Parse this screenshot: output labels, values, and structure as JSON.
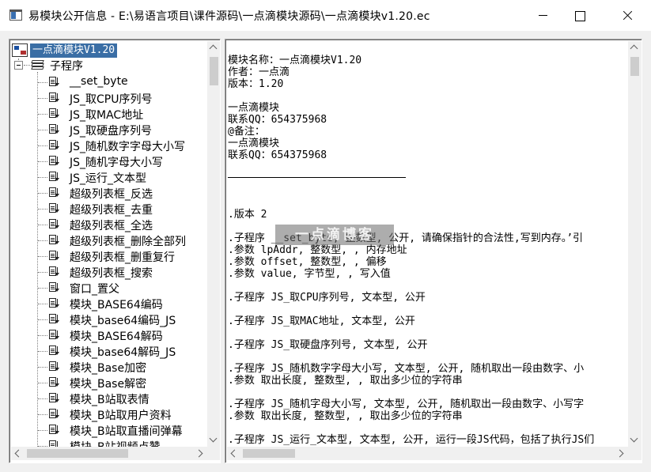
{
  "window": {
    "title": "易模块公开信息 - E:\\易语言项目\\课件源码\\一点滴模块源码\\一点滴模块v1.20.ec",
    "icon": "app-window-icon",
    "controls": [
      "minimize",
      "maximize",
      "close"
    ]
  },
  "tree": {
    "root_label": "一点滴模块V1.20",
    "root_icon": "module-icon",
    "folder_label": "子程序",
    "folder_icon": "stacked-books-icon",
    "item_icon": "subroutine-doc-arrow-icon",
    "items": [
      "__set_byte",
      "JS_取CPU序列号",
      "JS_取MAC地址",
      "JS_取硬盘序列号",
      "JS_随机数字字母大小写",
      "JS_随机字母大小写",
      "JS_运行_文本型",
      "超级列表框_反选",
      "超级列表框_去重",
      "超级列表框_全选",
      "超级列表框_删除全部列",
      "超级列表框_删重复行",
      "超级列表框_搜索",
      "窗口_置父",
      "模块_BASE64编码",
      "模块_base64编码_JS",
      "模块_BASE64解码",
      "模块_base64解码_JS",
      "模块_Base加密",
      "模块_Base解密",
      "模块_B站取表情",
      "模块_B站取用户资料",
      "模块_B站取直播间弹幕",
      "模块_B站视频点赞"
    ]
  },
  "content": {
    "lines": [
      "模块名称：一点滴模块V1.20",
      "作者：一点滴",
      "版本：1.20",
      "",
      "一点滴模块",
      "联系QQ：654375968",
      "@备注：",
      "一点滴模块",
      "联系QQ：654375968",
      "",
      "",
      "",
      "",
      ".版本 2",
      "",
      ".子程序 __set_byte, 整数型, 公开, 请确保指针的合法性,写到内存。’引",
      ".参数 lpAddr, 整数型, , 内存地址",
      ".参数 offset, 整数型, , 偏移",
      ".参数 value, 字节型, , 写入值",
      "",
      ".子程序 JS_取CPU序列号, 文本型, 公开",
      "",
      ".子程序 JS_取MAC地址, 文本型, 公开",
      "",
      ".子程序 JS_取硬盘序列号, 文本型, 公开",
      "",
      ".子程序 JS_随机数字字母大小写, 文本型, 公开, 随机取出一段由数字、小",
      ".参数 取出长度, 整数型, , 取出多少位的字符串",
      "",
      ".子程序 JS_随机字母大小写, 文本型, 公开, 随机取出一段由数字、小写字",
      ".参数 取出长度, 整数型, , 取出多少位的字符串",
      "",
      ".子程序 JS_运行_文本型, 文本型, 公开, 运行一段JS代码，包括了执行JS们"
    ],
    "watermark": "一点滴博客"
  }
}
